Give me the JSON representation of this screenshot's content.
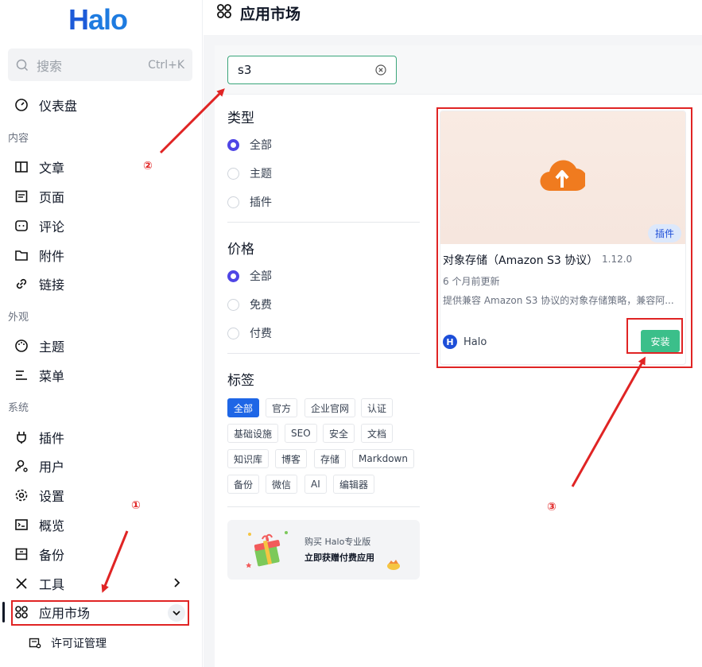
{
  "sidebar": {
    "logo": "Halo",
    "search": {
      "placeholder": "搜索",
      "shortcut": "Ctrl+K"
    },
    "items": {
      "dashboard": "仪表盘",
      "group_content": "内容",
      "posts": "文章",
      "pages": "页面",
      "comments": "评论",
      "attachments": "附件",
      "links": "链接",
      "group_appearance": "外观",
      "themes": "主题",
      "menus": "菜单",
      "group_system": "系统",
      "plugins": "插件",
      "users": "用户",
      "settings": "设置",
      "overview": "概览",
      "backup": "备份",
      "tools": "工具",
      "app_market": "应用市场",
      "license": "许可证管理"
    }
  },
  "header": {
    "title": "应用市场"
  },
  "search_input": {
    "value": "s3"
  },
  "filters": {
    "type": {
      "title": "类型",
      "options": [
        "全部",
        "主题",
        "插件"
      ],
      "selected": "全部"
    },
    "price": {
      "title": "价格",
      "options": [
        "全部",
        "免费",
        "付费"
      ],
      "selected": "全部"
    },
    "tags": {
      "title": "标签",
      "items": [
        "全部",
        "官方",
        "企业官网",
        "认证",
        "基础设施",
        "SEO",
        "安全",
        "文档",
        "知识库",
        "博客",
        "存储",
        "Markdown",
        "备份",
        "微信",
        "AI",
        "编辑器"
      ],
      "selected": "全部"
    }
  },
  "promo": {
    "line1": "购买 Halo专业版",
    "line2": "立即获赠付费应用"
  },
  "card": {
    "badge": "插件",
    "name": "对象存储（Amazon S3 协议）",
    "version": "1.12.0",
    "updated": "6 个月前更新",
    "description": "提供兼容 Amazon S3 协议的对象存储策略，兼容阿...",
    "author": "Halo",
    "author_initial": "H",
    "install": "安装"
  },
  "annotations": {
    "one": "①",
    "two": "②",
    "three": "③"
  },
  "colors": {
    "accent": "#1e66e6",
    "highlight": "#e02424",
    "install": "#3bbf8a",
    "radio": "#4f46e5"
  }
}
